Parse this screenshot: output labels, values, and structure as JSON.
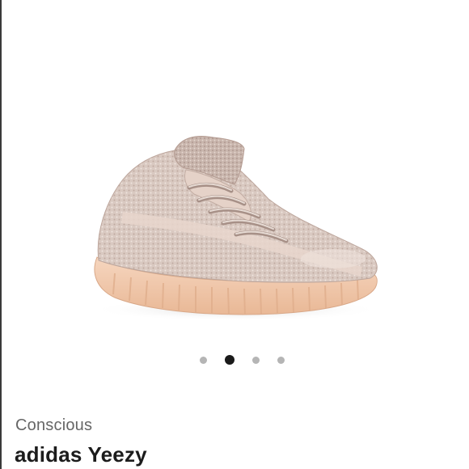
{
  "listing": {
    "brand": "Conscious",
    "title": "adidas Yeezy"
  },
  "gallery": {
    "image_count": 4,
    "active_index": 1
  },
  "colors": {
    "dot_active": "#1a1a1a",
    "dot_inactive": "#b5b5b5",
    "sole": "#f0c7a9",
    "knit": "#d6c6be"
  }
}
